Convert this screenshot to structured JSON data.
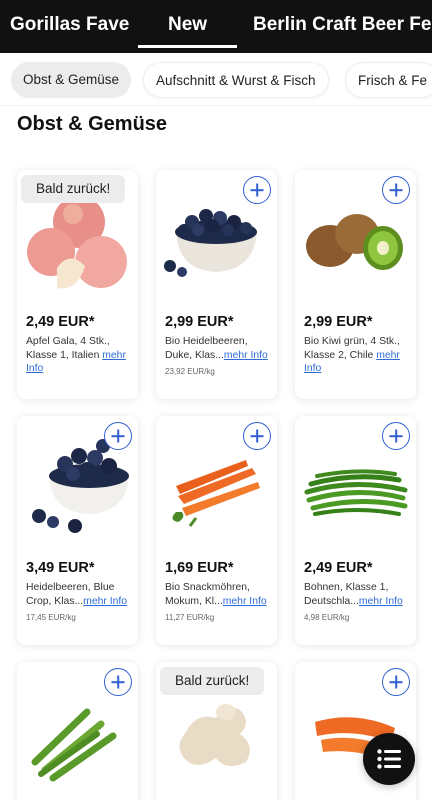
{
  "top_tabs": [
    {
      "label": "Gorillas Fave"
    },
    {
      "label": "New"
    },
    {
      "label": "Berlin Craft Beer Fe"
    }
  ],
  "active_tab": "New",
  "categories": [
    {
      "label": "Obst & Gemüse",
      "active": true
    },
    {
      "label": "Aufschnitt & Wurst & Fisch"
    },
    {
      "label": "Frisch & Fe"
    }
  ],
  "section_title": "Obst & Gemüse",
  "badge_label": "Bald zurück!",
  "more_info": "mehr Info",
  "products": [
    {
      "price": "2,49 EUR*",
      "desc": "Apfel Gala, 4 Stk., Klasse 1, Italien",
      "unit": "",
      "image": "apple-image",
      "badge": true
    },
    {
      "price": "2,99 EUR*",
      "desc": "Bio Heidelbeeren, Duke, Klas...",
      "unit": "23,92 EUR/kg",
      "image": "blueberries-bowl-image"
    },
    {
      "price": "2,99 EUR*",
      "desc": "Bio Kiwi grün, 4 Stk., Klasse 2, Chile",
      "unit": "",
      "image": "kiwi-image"
    },
    {
      "price": "3,49 EUR*",
      "desc": "Heidelbeeren, Blue Crop, Klas...",
      "unit": "17,45 EUR/kg",
      "image": "blueberries-bowl-image"
    },
    {
      "price": "1,69 EUR*",
      "desc": "Bio Snackmöhren, Mokum, Kl...",
      "unit": "11,27 EUR/kg",
      "image": "carrots-image"
    },
    {
      "price": "2,49 EUR*",
      "desc": "Bohnen, Klasse 1, Deutschla...",
      "unit": "4,98 EUR/kg",
      "image": "green-beans-image"
    },
    {
      "price": "",
      "desc": "",
      "unit": "",
      "image": "green-asparagus-image"
    },
    {
      "price": "",
      "desc": "",
      "unit": "",
      "image": "ginger-image",
      "badge": true
    },
    {
      "price": "",
      "desc": "",
      "unit": "",
      "image": "carrots-image"
    }
  ],
  "colors": {
    "topbar": "#111111",
    "link": "#2f6bd6",
    "add_button": "#2f5fd0"
  },
  "icons": {
    "add": "plus-circle-icon",
    "menu": "list-menu-icon"
  }
}
